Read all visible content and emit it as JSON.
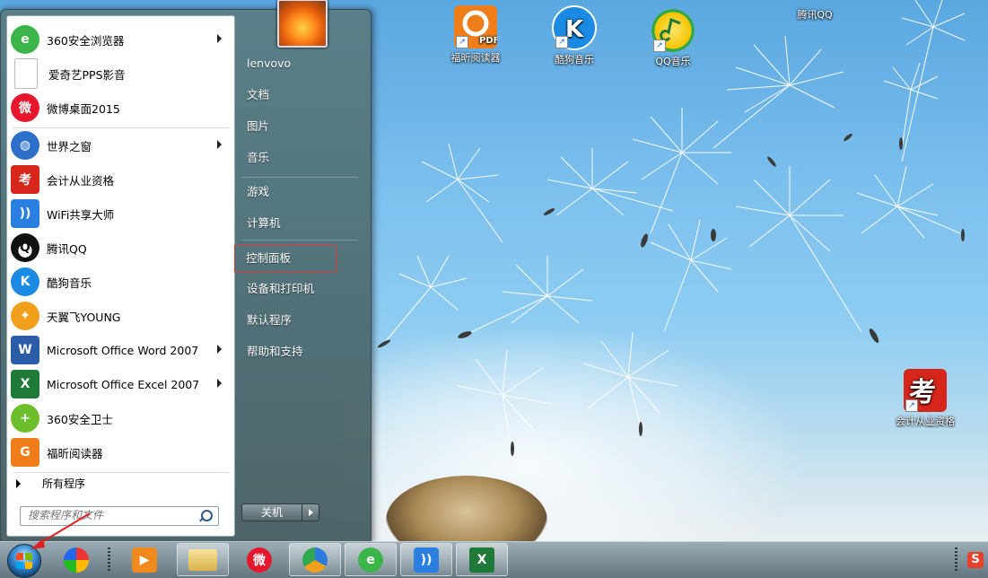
{
  "desktop": {
    "icons": [
      {
        "label": "福昕阅读器",
        "icon": "foxit-pdf-icon"
      },
      {
        "label": "酷狗音乐",
        "icon": "kugou-icon"
      },
      {
        "label": "QQ音乐",
        "icon": "qq-music-icon"
      },
      {
        "label": "腾讯QQ",
        "icon": "qq-icon"
      },
      {
        "label": "会计从业资格",
        "icon": "kao-icon"
      }
    ]
  },
  "start_menu": {
    "programs": [
      {
        "label": "360安全浏览器",
        "icon": "360-browser-icon",
        "color": "#3bb44a",
        "submenu": true
      },
      {
        "label": "爱奇艺PPS影音",
        "icon": "pps-file-icon",
        "color": "#ffffff",
        "submenu": false
      },
      {
        "label": "微博桌面2015",
        "icon": "weibo-icon",
        "color": "#e6162d",
        "submenu": false
      },
      {
        "label": "世界之窗",
        "icon": "theworld-globe-icon",
        "color": "#2e6fc9",
        "submenu": true
      },
      {
        "label": "会计从业资格",
        "icon": "kao-icon",
        "color": "#d7261c",
        "submenu": false
      },
      {
        "label": "WiFi共享大师",
        "icon": "wifi-icon",
        "color": "#2a7fe0",
        "submenu": false
      },
      {
        "label": "腾讯QQ",
        "icon": "qq-penguin-icon",
        "color": "#111111",
        "submenu": false
      },
      {
        "label": "酷狗音乐",
        "icon": "kugou-icon",
        "color": "#1b8ae3",
        "submenu": false
      },
      {
        "label": "天翼飞YOUNG",
        "icon": "tianyi-icon",
        "color": "#f1a01c",
        "submenu": false
      },
      {
        "label": "Microsoft Office Word 2007",
        "icon": "word-icon",
        "color": "#2b5ca8",
        "submenu": true
      },
      {
        "label": "Microsoft Office Excel 2007",
        "icon": "excel-icon",
        "color": "#1f7a3a",
        "submenu": true
      },
      {
        "label": "360安全卫士",
        "icon": "360-safe-icon",
        "color": "#6cbf2a",
        "submenu": false
      },
      {
        "label": "福昕阅读器",
        "icon": "foxit-pdf-icon",
        "color": "#ef7d1a",
        "submenu": false
      }
    ],
    "all_programs": "所有程序",
    "search_placeholder": "搜索程序和文件",
    "right": {
      "items": [
        "lenvovo",
        "文档",
        "图片",
        "音乐",
        "游戏",
        "计算机",
        "控制面板",
        "设备和打印机",
        "默认程序",
        "帮助和支持"
      ],
      "highlighted": "控制面板"
    },
    "shutdown_label": "关机"
  },
  "taskbar": {
    "buttons": [
      {
        "name": "taskbar-start-icon-colorful"
      },
      {
        "name": "taskbar-media-player"
      },
      {
        "name": "taskbar-explorer"
      },
      {
        "name": "taskbar-weibo"
      },
      {
        "name": "taskbar-tianyi"
      },
      {
        "name": "taskbar-360-browser"
      },
      {
        "name": "taskbar-wifi"
      },
      {
        "name": "taskbar-excel"
      }
    ],
    "tray_icon": "S"
  }
}
